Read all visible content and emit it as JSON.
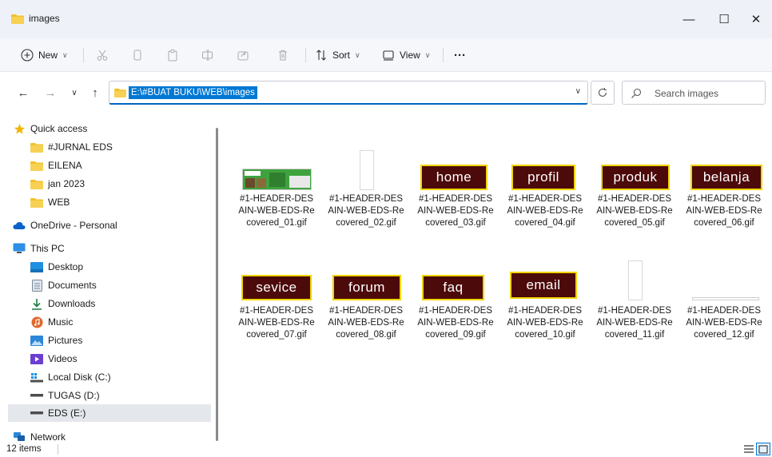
{
  "window": {
    "title": "images",
    "minimize": "—",
    "maximize": "☐",
    "close": "✕"
  },
  "commandbar": {
    "new_label": "New",
    "sort_label": "Sort",
    "view_label": "View",
    "more_label": "···"
  },
  "address": {
    "path": "E:\\#BUAT BUKU\\WEB\\images",
    "search_placeholder": "Search images"
  },
  "sidebar": {
    "quick_access": "Quick access",
    "quick_items": [
      "#JURNAL EDS",
      "EILENA",
      "jan 2023",
      "WEB"
    ],
    "onedrive": "OneDrive - Personal",
    "this_pc": "This PC",
    "pc_items": [
      "Desktop",
      "Documents",
      "Downloads",
      "Music",
      "Pictures",
      "Videos",
      "Local Disk (C:)",
      "TUGAS (D:)",
      "EDS (E:)"
    ],
    "network": "Network"
  },
  "files": [
    {
      "name": "#1-HEADER-DESAIN-WEB-EDS-Recovered_01.gif",
      "line1": "#1-HEADER-DES",
      "line2": "AIN-WEB-EDS-Re",
      "line3": "covered_01.gif",
      "kind": "header-thumb",
      "label": ""
    },
    {
      "name": "#1-HEADER-DESAIN-WEB-EDS-Recovered_02.gif",
      "line1": "#1-HEADER-DES",
      "line2": "AIN-WEB-EDS-Re",
      "line3": "covered_02.gif",
      "kind": "blank-tall",
      "label": ""
    },
    {
      "name": "#1-HEADER-DESAIN-WEB-EDS-Recovered_03.gif",
      "line1": "#1-HEADER-DES",
      "line2": "AIN-WEB-EDS-Re",
      "line3": "covered_03.gif",
      "kind": "button",
      "label": "home"
    },
    {
      "name": "#1-HEADER-DESAIN-WEB-EDS-Recovered_04.gif",
      "line1": "#1-HEADER-DES",
      "line2": "AIN-WEB-EDS-Re",
      "line3": "covered_04.gif",
      "kind": "button",
      "label": "profil"
    },
    {
      "name": "#1-HEADER-DESAIN-WEB-EDS-Recovered_05.gif",
      "line1": "#1-HEADER-DES",
      "line2": "AIN-WEB-EDS-Re",
      "line3": "covered_05.gif",
      "kind": "button",
      "label": "produk"
    },
    {
      "name": "#1-HEADER-DESAIN-WEB-EDS-Recovered_06.gif",
      "line1": "#1-HEADER-DES",
      "line2": "AIN-WEB-EDS-Re",
      "line3": "covered_06.gif",
      "kind": "button",
      "label": "belanja"
    },
    {
      "name": "#1-HEADER-DESAIN-WEB-EDS-Recovered_07.gif",
      "line1": "#1-HEADER-DES",
      "line2": "AIN-WEB-EDS-Re",
      "line3": "covered_07.gif",
      "kind": "button",
      "label": "sevice"
    },
    {
      "name": "#1-HEADER-DESAIN-WEB-EDS-Recovered_08.gif",
      "line1": "#1-HEADER-DES",
      "line2": "AIN-WEB-EDS-Re",
      "line3": "covered_08.gif",
      "kind": "button",
      "label": "forum"
    },
    {
      "name": "#1-HEADER-DESAIN-WEB-EDS-Recovered_09.gif",
      "line1": "#1-HEADER-DES",
      "line2": "AIN-WEB-EDS-Re",
      "line3": "covered_09.gif",
      "kind": "button",
      "label": "faq"
    },
    {
      "name": "#1-HEADER-DESAIN-WEB-EDS-Recovered_10.gif",
      "line1": "#1-HEADER-DES",
      "line2": "AIN-WEB-EDS-Re",
      "line3": "covered_10.gif",
      "kind": "button",
      "label": "email"
    },
    {
      "name": "#1-HEADER-DESAIN-WEB-EDS-Recovered_11.gif",
      "line1": "#1-HEADER-DES",
      "line2": "AIN-WEB-EDS-Re",
      "line3": "covered_11.gif",
      "kind": "blank-tall",
      "label": ""
    },
    {
      "name": "#1-HEADER-DESAIN-WEB-EDS-Recovered_12.gif",
      "line1": "#1-HEADER-DES",
      "line2": "AIN-WEB-EDS-Re",
      "line3": "covered_12.gif",
      "kind": "blank-wide",
      "label": ""
    }
  ],
  "status": {
    "item_count": "12 items"
  },
  "colors": {
    "accent": "#0078d4",
    "folder": "#f2c12e",
    "button_bg": "#4c0a0a",
    "button_border": "#f0d400"
  }
}
